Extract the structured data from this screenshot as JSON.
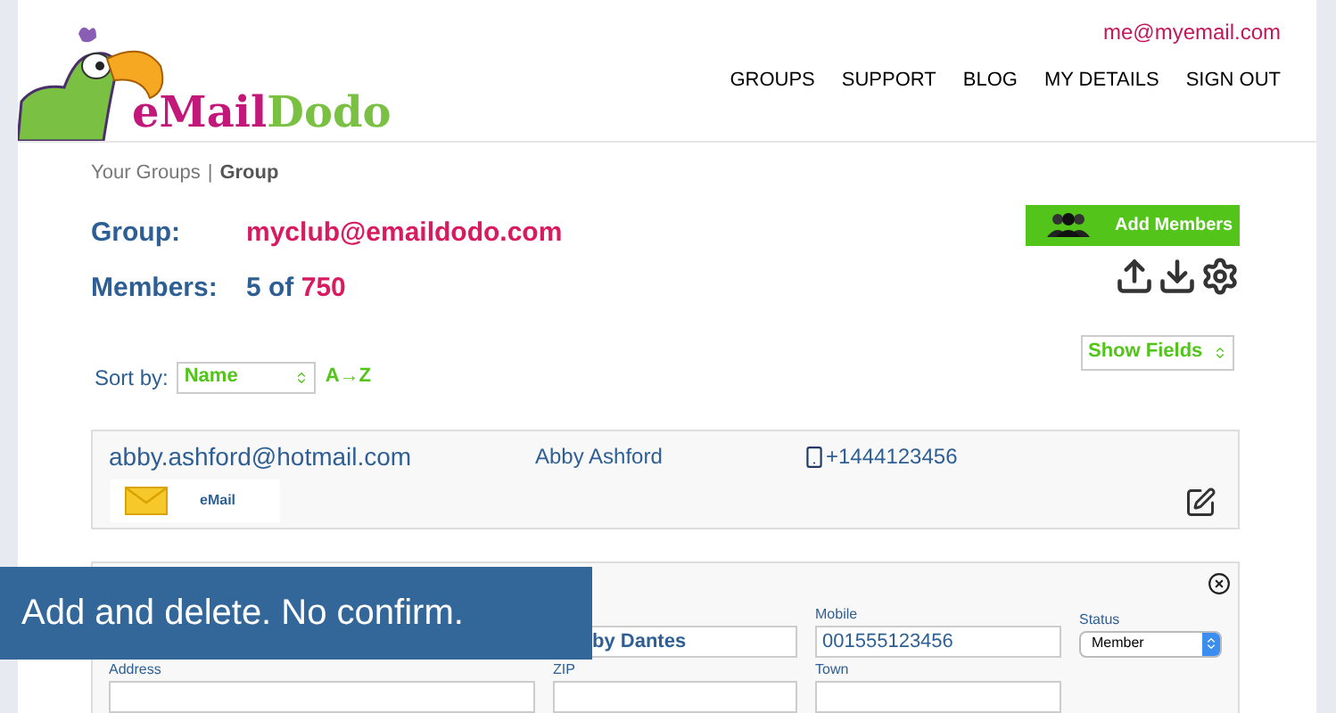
{
  "header": {
    "logo": {
      "first": "eMail",
      "second": "Dodo"
    },
    "account_email": "me@myemail.com",
    "nav": [
      "GROUPS",
      "SUPPORT",
      "BLOG",
      "MY DETAILS",
      "SIGN OUT"
    ]
  },
  "breadcrumb": {
    "items": [
      {
        "label": "Your Groups",
        "current": false
      },
      {
        "label": "Group",
        "current": true
      }
    ],
    "separator": "|"
  },
  "group": {
    "group_label": "Group:",
    "group_value": "myclub@emaildodo.com",
    "members_label": "Members:",
    "members_count": "5",
    "members_of": "of",
    "members_limit": "750"
  },
  "add_members_button": "Add Members",
  "sort": {
    "label": "Sort by:",
    "field": "Name",
    "order": "A→Z"
  },
  "show_fields": "Show Fields",
  "members": [
    {
      "email": "abby.ashford@hotmail.com",
      "name": "Abby Ashford",
      "phone": "+1444123456",
      "channel": "eMail"
    }
  ],
  "edit_form": {
    "fields": [
      {
        "label": "Mobile",
        "value": "001555123456"
      },
      {
        "label": "Status",
        "value": "Member"
      }
    ],
    "name_value": "by Dantes",
    "second_row": [
      {
        "label": "Address"
      },
      {
        "label": "ZIP"
      },
      {
        "label": "Town"
      }
    ]
  },
  "banner": "Add and delete. No confirm."
}
